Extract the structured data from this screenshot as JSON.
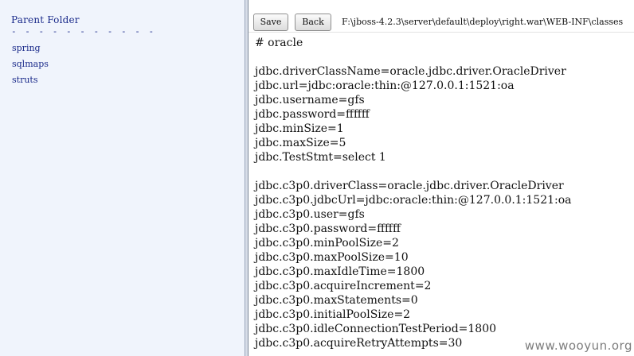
{
  "sidebar": {
    "title": "Parent Folder",
    "separator": "- - - - - - - - - - -",
    "items": [
      {
        "label": "spring"
      },
      {
        "label": "sqlmaps"
      },
      {
        "label": "struts"
      }
    ]
  },
  "toolbar": {
    "save_label": "Save",
    "back_label": "Back",
    "path": "F:\\jboss-4.2.3\\server\\default\\deploy\\right.war\\WEB-INF\\classes"
  },
  "editor": {
    "content": "# oracle\n\njdbc.driverClassName=oracle.jdbc.driver.OracleDriver\njdbc.url=jdbc:oracle:thin:@127.0.0.1:1521:oa\njdbc.username=gfs\njdbc.password=ffffff\njdbc.minSize=1\njdbc.maxSize=5\njdbc.TestStmt=select 1\n\njdbc.c3p0.driverClass=oracle.jdbc.driver.OracleDriver\njdbc.c3p0.jdbcUrl=jdbc:oracle:thin:@127.0.0.1:1521:oa\njdbc.c3p0.user=gfs\njdbc.c3p0.password=ffffff\njdbc.c3p0.minPoolSize=2\njdbc.c3p0.maxPoolSize=10\njdbc.c3p0.maxIdleTime=1800\njdbc.c3p0.acquireIncrement=2\njdbc.c3p0.maxStatements=0\njdbc.c3p0.initialPoolSize=2\njdbc.c3p0.idleConnectionTestPeriod=1800\njdbc.c3p0.acquireRetryAttempts=30"
  },
  "watermark": "www.wooyun.org"
}
